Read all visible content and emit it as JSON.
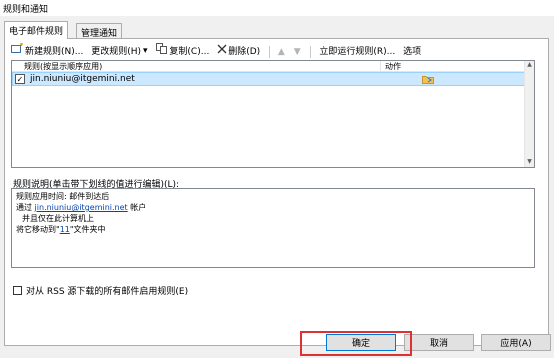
{
  "window": {
    "title": "规则和通知"
  },
  "tabs": [
    {
      "label": "电子邮件规则",
      "active": true
    },
    {
      "label": "管理通知",
      "active": false
    }
  ],
  "toolbar": {
    "new_rule": "新建规则(N)...",
    "change_rule": "更改规则(H)",
    "copy": "复制(C)...",
    "delete": "删除(D)",
    "run_now": "立即运行规则(R)...",
    "options": "选项"
  },
  "rules_table": {
    "columns": [
      "规则(按显示顺序应用)",
      "动作"
    ],
    "rows": [
      {
        "checked": true,
        "name": "jin.niuniu@itgemini.net",
        "action_icon": "folder-move-icon"
      }
    ]
  },
  "description": {
    "label": "规则说明(单击带下划线的值进行编辑)(L):",
    "line1": "规则应用时间: 邮件到达后",
    "line2_prefix": "通过 ",
    "line2_link": "jin.niuniu@itgemini.net",
    "line2_suffix": " 帐户",
    "line3": "并且仅在此计算机上",
    "line4_prefix": "将它移动到\"",
    "line4_link": "11",
    "line4_suffix": "\"文件夹中"
  },
  "rss_option": {
    "label": "对从 RSS 源下载的所有邮件启用规则(E)",
    "checked": false
  },
  "buttons": {
    "ok": "确定",
    "cancel": "取消",
    "apply": "应用(A)"
  },
  "colors": {
    "selection": "#cce8ff",
    "link": "#0645ad",
    "highlight": "#e03030"
  }
}
